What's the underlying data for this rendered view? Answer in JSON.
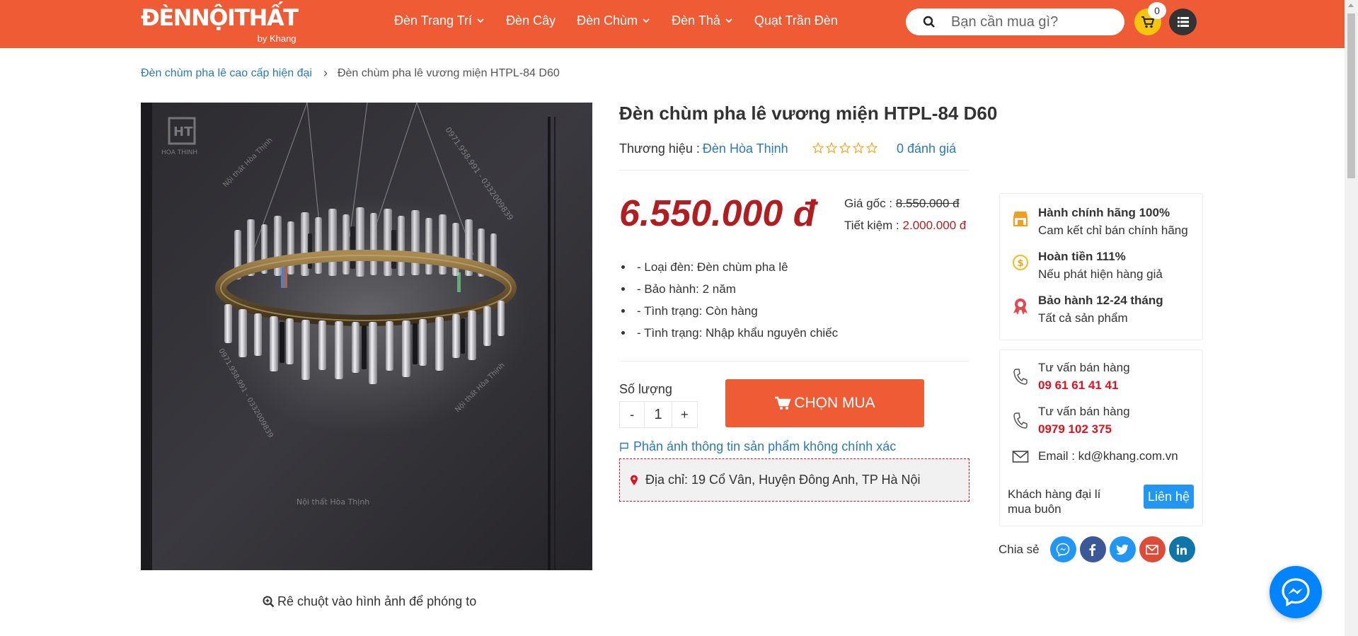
{
  "header": {
    "logo": {
      "main": "ĐÈNNỘITHẤT",
      "sub": "by Khang"
    },
    "nav": [
      {
        "label": "Đèn Trang Trí",
        "has_dropdown": true
      },
      {
        "label": "Đèn Cây",
        "has_dropdown": false
      },
      {
        "label": "Đèn Chùm",
        "has_dropdown": true
      },
      {
        "label": "Đèn Thả",
        "has_dropdown": true
      },
      {
        "label": "Quạt Trần Đèn",
        "has_dropdown": false
      }
    ],
    "search": {
      "placeholder": "Bạn cần mua gì?",
      "value": ""
    },
    "cart_count": "0"
  },
  "breadcrumb": {
    "parent": "Đèn chùm pha lê cao cấp hiện đại",
    "separator": "›",
    "current": "Đèn chùm pha lê vương miện HTPL-84 D60"
  },
  "gallery": {
    "watermark_brand": "HOA THINH",
    "watermark_phone": "0971.958.991 - 0332009839",
    "watermark_text": "Nội thất Hòa Thịnh",
    "zoom_hint": "Rê chuột vào hình ảnh để phóng to"
  },
  "product": {
    "title": "Đèn chùm pha lê vương miện HTPL-84 D60",
    "brand_label": "Thương hiệu :",
    "brand": "Đèn Hòa Thịnh",
    "rating": 0,
    "rating_max": 5,
    "reviews": "0 đánh giá",
    "price": "6.550.000 đ",
    "original_price_label": "Giá gốc :",
    "original_price": "8.550.000 đ",
    "savings_label": "Tiết kiệm :",
    "savings": "2.000.000 đ",
    "specs": [
      "- Loại đèn: Đèn chùm pha lê",
      "- Bảo hành: 2 năm",
      "- Tình trạng: Còn hàng",
      "- Tình trạng: Nhập khẩu nguyên chiếc"
    ],
    "quantity_label": "Số lượng",
    "quantity": "1",
    "minus": "-",
    "plus": "+",
    "buy_label": "CHỌN MUA",
    "report_link": "Phản ánh thông tin sản phẩm không chính xác",
    "address": "Địa chỉ: 19 Cổ Vân, Huyện Đông Anh, TP Hà Nội"
  },
  "sidebar": {
    "features": [
      {
        "icon": "store-icon",
        "title": "Hành chính hãng 100%",
        "desc": "Cam kết chỉ bán chính hãng"
      },
      {
        "icon": "refund-coin-icon",
        "title": "Hoàn tiền 111%",
        "desc": "Nếu phát hiện hàng giả"
      },
      {
        "icon": "warranty-ribbon-icon",
        "title": "Bảo hành 12-24 tháng",
        "desc": "Tất cả sản phẩm"
      }
    ],
    "contacts": [
      {
        "icon": "phone-icon",
        "label": "Tư vấn bán hàng",
        "value": "09 61 61 41 41"
      },
      {
        "icon": "phone-icon",
        "label": "Tư vấn bán hàng",
        "value": "0979 102 375"
      },
      {
        "icon": "mail-icon",
        "label": "Email : kd@khang.com.vn",
        "value": ""
      }
    ],
    "dealer_text": "Khách hàng đại lí mua buôn",
    "dealer_button": "Liên hệ",
    "share_label": "Chia sẻ",
    "share": [
      {
        "name": "messenger",
        "color": "#2196f3"
      },
      {
        "name": "facebook",
        "color": "#3b5998"
      },
      {
        "name": "twitter",
        "color": "#2196f3"
      },
      {
        "name": "gmail",
        "color": "#dd4b39"
      },
      {
        "name": "linkedin",
        "color": "#0e76a8"
      }
    ]
  },
  "colors": {
    "brand": "#ef5b34",
    "price": "#b11e22",
    "link": "#2a7ab8",
    "accent_yellow": "#f6c50e"
  }
}
